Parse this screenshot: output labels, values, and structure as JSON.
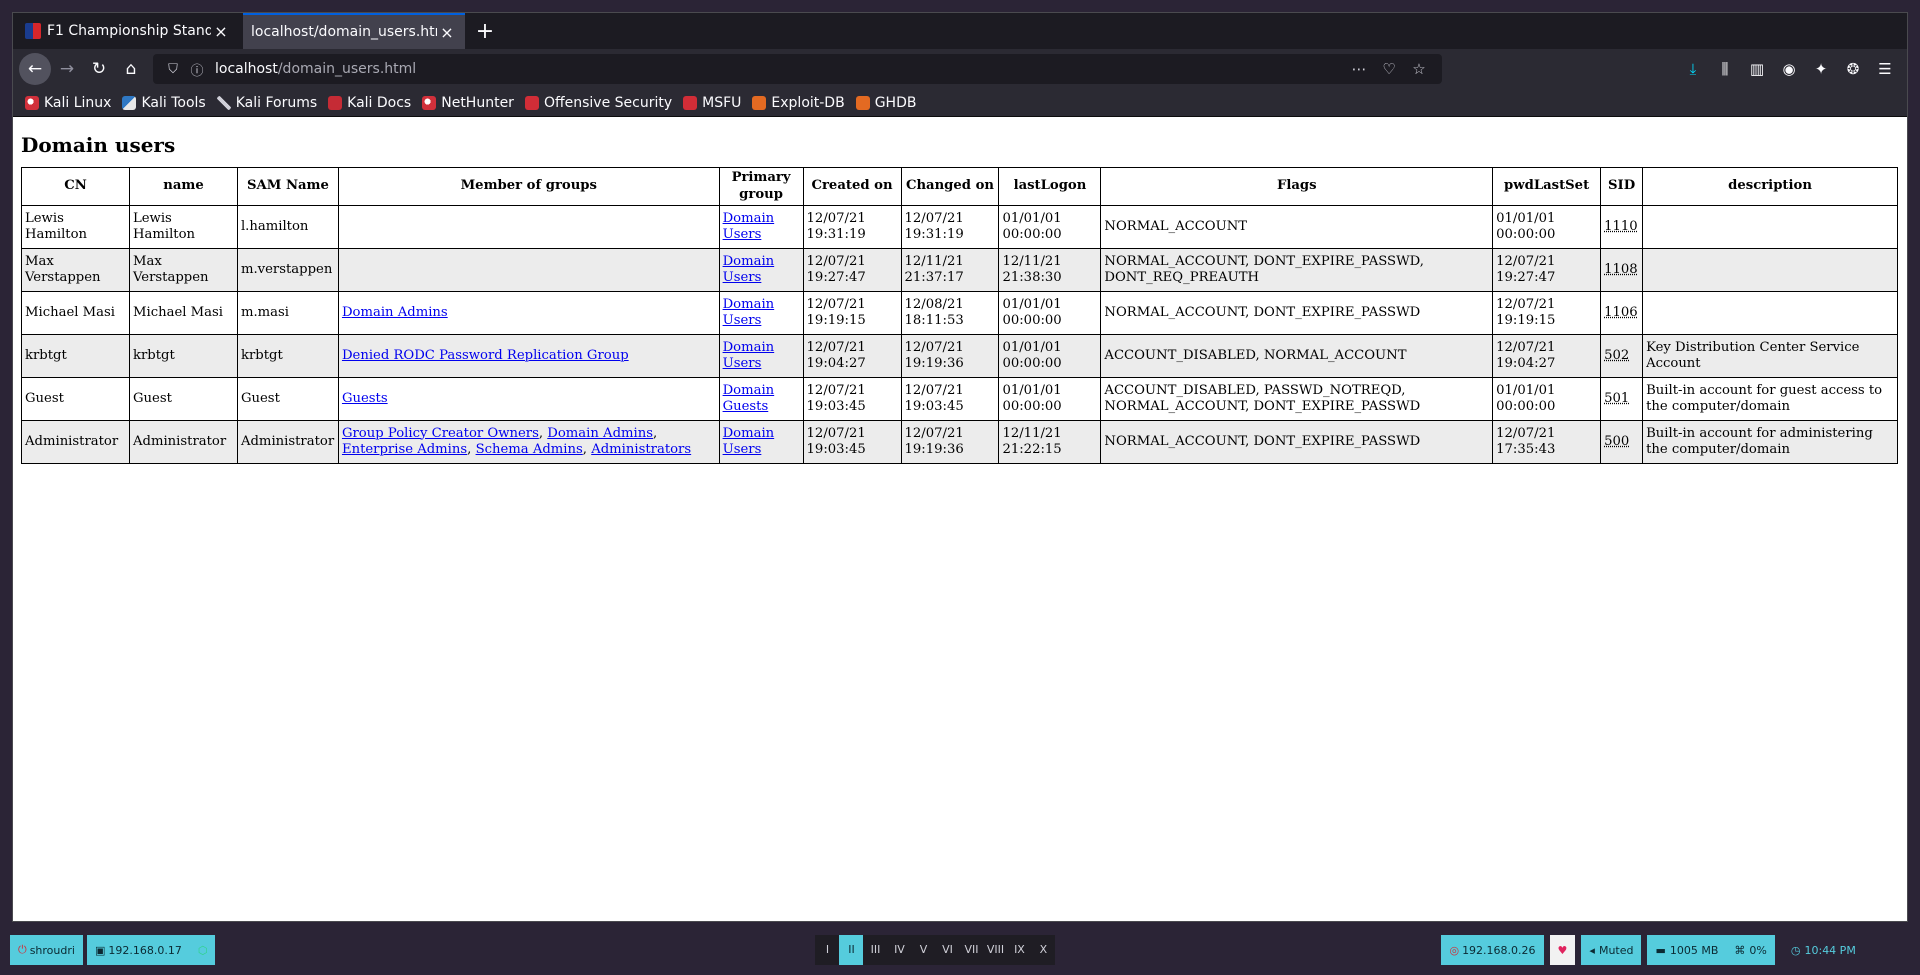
{
  "browser": {
    "tabs": [
      {
        "title": "F1 Championship Standi",
        "active": false
      },
      {
        "title": "localhost/domain_users.htm",
        "active": true
      }
    ],
    "url": {
      "host": "localhost",
      "path": "/domain_users.html"
    },
    "bookmarks": [
      {
        "label": "Kali Linux",
        "icon": "kali-icon"
      },
      {
        "label": "Kali Tools",
        "icon": "kali-tools-icon"
      },
      {
        "label": "Kali Forums",
        "icon": "kali-forums-icon"
      },
      {
        "label": "Kali Docs",
        "icon": "kali-docs-icon"
      },
      {
        "label": "NetHunter",
        "icon": "nethunter-icon"
      },
      {
        "label": "Offensive Security",
        "icon": "offsec-icon"
      },
      {
        "label": "MSFU",
        "icon": "msfu-icon"
      },
      {
        "label": "Exploit-DB",
        "icon": "exploitdb-icon"
      },
      {
        "label": "GHDB",
        "icon": "ghdb-icon"
      }
    ]
  },
  "page": {
    "title": "Domain users",
    "columns": [
      "CN",
      "name",
      "SAM Name",
      "Member of groups",
      "Primary group",
      "Created on",
      "Changed on",
      "lastLogon",
      "Flags",
      "pwdLastSet",
      "SID",
      "description"
    ],
    "rows": [
      {
        "cn": "Lewis Hamilton",
        "name": "Lewis Hamilton",
        "sam": "l.hamilton",
        "groups": [],
        "primary": "Domain Users",
        "created": "12/07/21 19:31:19",
        "changed": "12/07/21 19:31:19",
        "lastlogon": "01/01/01 00:00:00",
        "flags": "NORMAL_ACCOUNT",
        "pwdlastset": "01/01/01 00:00:00",
        "sid": "1110",
        "description": ""
      },
      {
        "cn": "Max Verstappen",
        "name": "Max Verstappen",
        "sam": "m.verstappen",
        "groups": [],
        "primary": "Domain Users",
        "created": "12/07/21 19:27:47",
        "changed": "12/11/21 21:37:17",
        "lastlogon": "12/11/21 21:38:30",
        "flags": "NORMAL_ACCOUNT, DONT_EXPIRE_PASSWD, DONT_REQ_PREAUTH",
        "pwdlastset": "12/07/21 19:27:47",
        "sid": "1108",
        "description": ""
      },
      {
        "cn": "Michael Masi",
        "name": "Michael Masi",
        "sam": "m.masi",
        "groups": [
          "Domain Admins"
        ],
        "primary": "Domain Users",
        "created": "12/07/21 19:19:15",
        "changed": "12/08/21 18:11:53",
        "lastlogon": "01/01/01 00:00:00",
        "flags": "NORMAL_ACCOUNT, DONT_EXPIRE_PASSWD",
        "pwdlastset": "12/07/21 19:19:15",
        "sid": "1106",
        "description": ""
      },
      {
        "cn": "krbtgt",
        "name": "krbtgt",
        "sam": "krbtgt",
        "groups": [
          "Denied RODC Password Replication Group"
        ],
        "primary": "Domain Users",
        "created": "12/07/21 19:04:27",
        "changed": "12/07/21 19:19:36",
        "lastlogon": "01/01/01 00:00:00",
        "flags": "ACCOUNT_DISABLED, NORMAL_ACCOUNT",
        "pwdlastset": "12/07/21 19:04:27",
        "sid": "502",
        "description": "Key Distribution Center Service Account"
      },
      {
        "cn": "Guest",
        "name": "Guest",
        "sam": "Guest",
        "groups": [
          "Guests"
        ],
        "primary": "Domain Guests",
        "created": "12/07/21 19:03:45",
        "changed": "12/07/21 19:03:45",
        "lastlogon": "01/01/01 00:00:00",
        "flags": "ACCOUNT_DISABLED, PASSWD_NOTREQD, NORMAL_ACCOUNT, DONT_EXPIRE_PASSWD",
        "pwdlastset": "01/01/01 00:00:00",
        "sid": "501",
        "description": "Built-in account for guest access to the computer/domain"
      },
      {
        "cn": "Administrator",
        "name": "Administrator",
        "sam": "Administrator",
        "groups": [
          "Group Policy Creator Owners",
          "Domain Admins",
          "Enterprise Admins",
          "Schema Admins",
          "Administrators"
        ],
        "primary": "Domain Users",
        "created": "12/07/21 19:03:45",
        "changed": "12/07/21 19:19:36",
        "lastlogon": "12/11/21 21:22:15",
        "flags": "NORMAL_ACCOUNT, DONT_EXPIRE_PASSWD",
        "pwdlastset": "12/07/21 17:35:43",
        "sid": "500",
        "description": "Built-in account for administering the computer/domain"
      }
    ]
  },
  "taskbar": {
    "user": "shroudri",
    "local_ip": "192.168.0.17",
    "workspaces": [
      "I",
      "II",
      "III",
      "IV",
      "V",
      "VI",
      "VII",
      "VIII",
      "IX",
      "X"
    ],
    "active_workspace": "II",
    "remote_ip": "192.168.0.26",
    "volume": "Muted",
    "memory": "1005 MB",
    "cpu": "0%",
    "clock": "10:44 PM",
    "colors": {
      "teal": "#55ccdd",
      "green": "#2fd38a",
      "red": "#e0245e"
    }
  }
}
